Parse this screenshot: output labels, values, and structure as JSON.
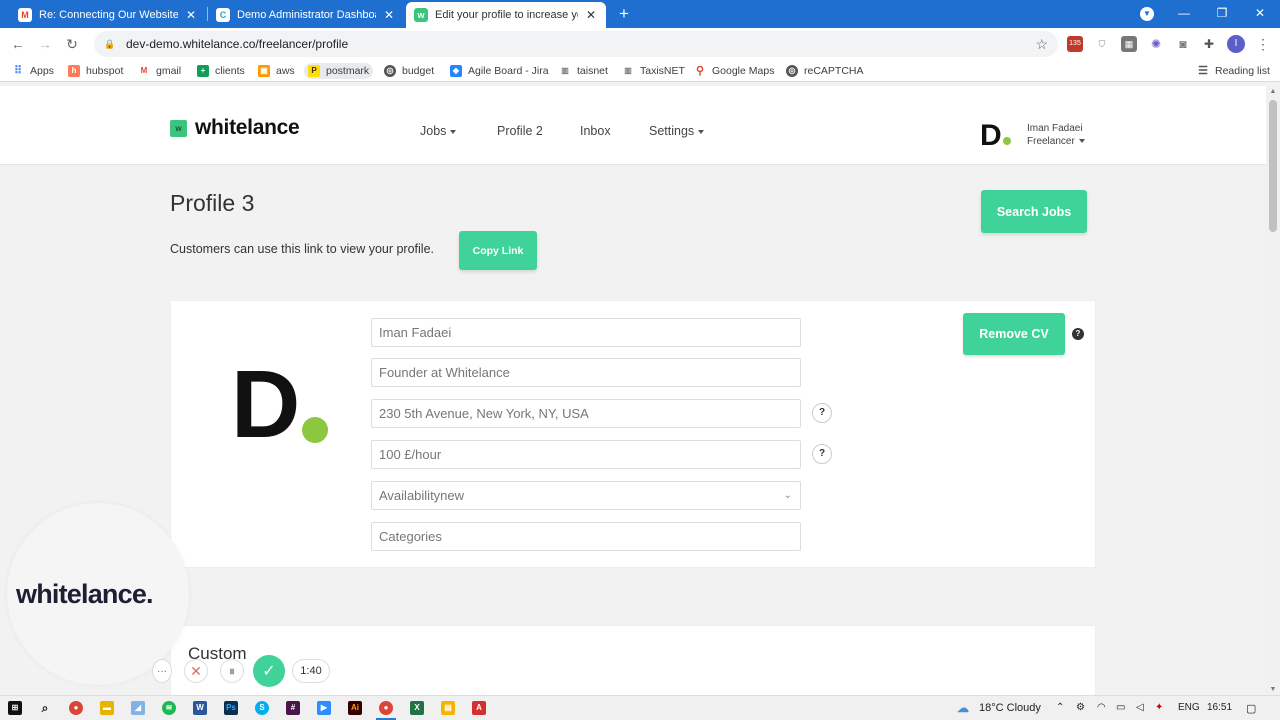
{
  "browser": {
    "tabs": [
      {
        "title": "Re: Connecting Our Website To T",
        "icon": "gmail-icon",
        "color": "#ea4335"
      },
      {
        "title": "Demo Administrator Dashboard",
        "icon": "site-icon",
        "color": "#2a9fd6"
      },
      {
        "title": "Edit your profile to increase your",
        "icon": "whitelance-icon",
        "color": "#3ac47d"
      }
    ],
    "url": "dev-demo.whitelance.co/freelancer/profile",
    "extensions_badge": "135",
    "profile_initial": "I",
    "bookmarks": [
      "Apps",
      "hubspot",
      "gmail",
      "clients",
      "aws",
      "postmark",
      "budget",
      "Agile Board - Jira",
      "taisnet",
      "TaxisNET",
      "Google Maps",
      "reCAPTCHA"
    ],
    "reading_list": "Reading list"
  },
  "site": {
    "logo_text": "whitelance",
    "logo_mark": "w",
    "nav": {
      "jobs": "Jobs",
      "profile": "Profile 2",
      "inbox": "Inbox",
      "settings": "Settings"
    },
    "user": {
      "initial": "D",
      "name": "Iman Fadaei",
      "role": "Freelancer"
    }
  },
  "page": {
    "title": "Profile 3",
    "search_jobs": "Search Jobs",
    "customers_text": "Customers can use this link to view your profile.",
    "copy_link": "Copy Link",
    "remove_cv": "Remove CV",
    "help_mark": "?",
    "avatar_letter": "D",
    "fields": {
      "name": "Iman Fadaei",
      "headline": "Founder at Whitelance",
      "location": "230 5th Avenue, New York, NY, USA",
      "rate": "100 £/hour",
      "availability": "Availabilitynew",
      "categories": "Categories"
    },
    "custom_title": "Custom"
  },
  "recorder": {
    "logo": "whitelance.",
    "timer": "1:40"
  },
  "taskbar": {
    "weather": "18°C  Cloudy",
    "language": "ENG",
    "time": "16:51"
  },
  "colors": {
    "accent": "#3fd39a",
    "brand_green": "#3ac47d",
    "lime": "#8dc63f",
    "chrome_blue": "#1f6fd1"
  }
}
